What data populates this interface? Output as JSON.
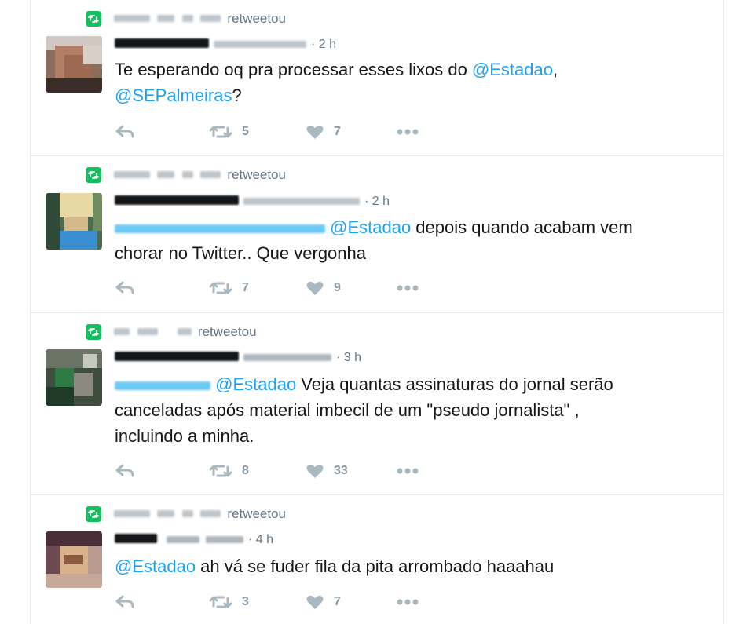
{
  "colors": {
    "retweet_badge": "#17bf63",
    "link": "#1da1f2",
    "muted": "#657786",
    "action_icon": "#aab8c2",
    "divider": "#e6ecf0"
  },
  "icons": {
    "retweet_badge": "retweet-icon",
    "reply": "reply-icon",
    "retweet": "retweet-icon",
    "like": "heart-icon",
    "more": "more-dots-icon"
  },
  "tweets": [
    {
      "retweet_label": "retweetou",
      "time": "· 2 h",
      "text_parts": [
        "Te esperando oq pra processar esses lixos do ",
        "@Estadao",
        ",",
        "@SEPalmeiras",
        "?"
      ],
      "retweets": "5",
      "likes": "7"
    },
    {
      "retweet_label": "retweetou",
      "time": "· 2 h",
      "text_parts": [
        "@Estadao",
        " depois quando acabam vem",
        "chorar no Twitter.. Que vergonha"
      ],
      "retweets": "7",
      "likes": "9"
    },
    {
      "retweet_label": "retweetou",
      "time": "· 3 h",
      "text_parts": [
        "@Estadao",
        " Veja quantas assinaturas do jornal serão",
        "canceladas após material imbecil de um \"pseudo jornalista\" ,",
        "incluindo a minha."
      ],
      "retweets": "8",
      "likes": "33"
    },
    {
      "retweet_label": "retweetou",
      "time": "· 4 h",
      "text_parts": [
        "@Estadao",
        " ah vá se fuder fila da pita arrombado haaahau"
      ],
      "retweets": "3",
      "likes": "7"
    }
  ]
}
